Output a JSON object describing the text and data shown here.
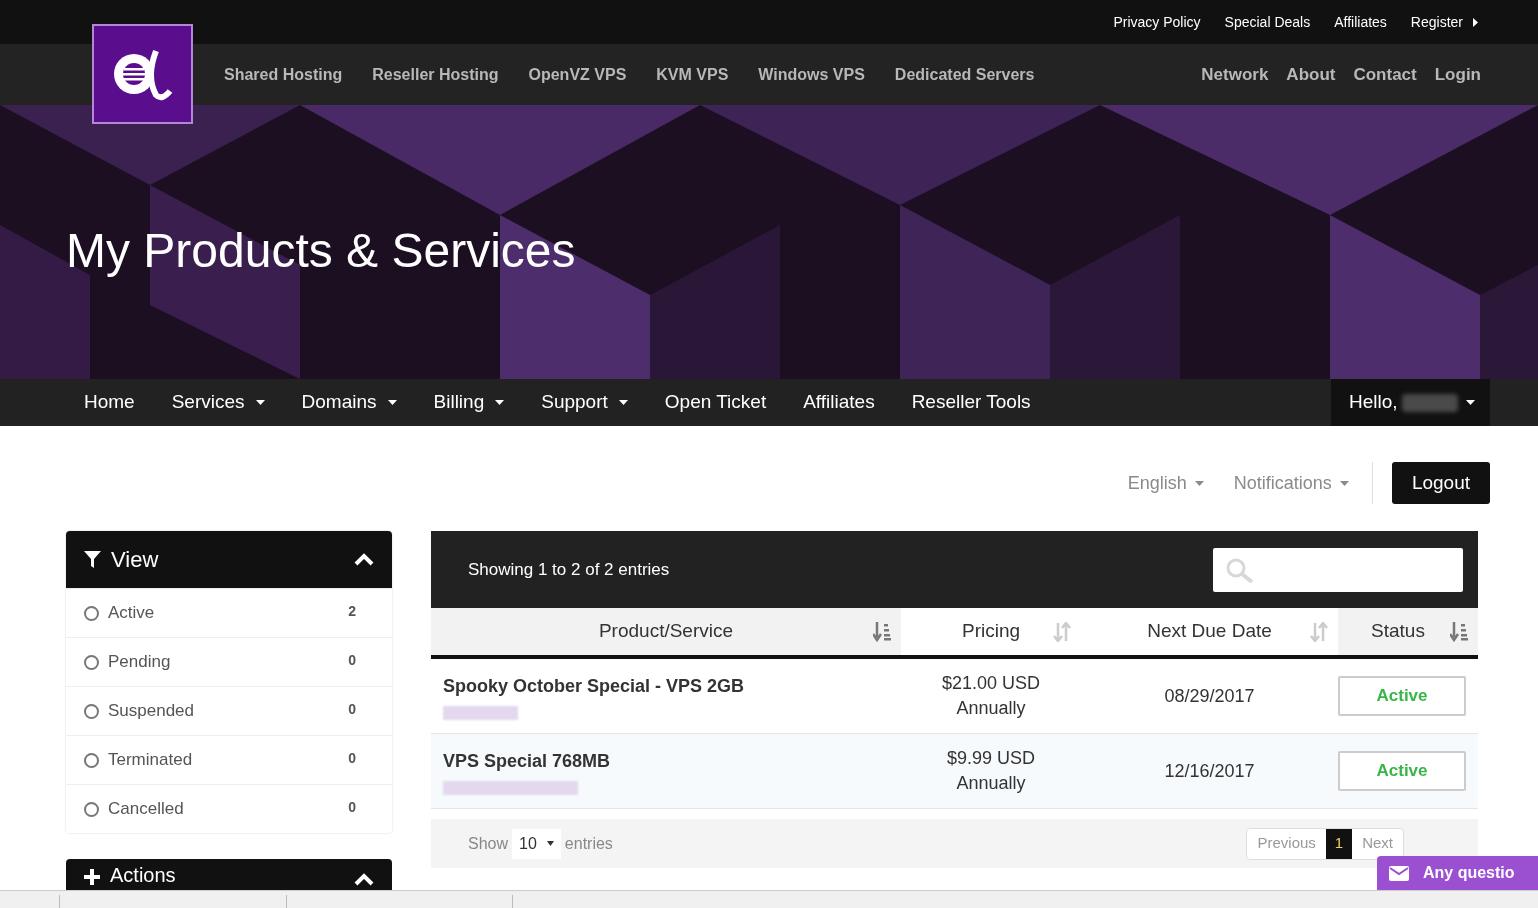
{
  "top_links": [
    {
      "label": "Privacy Policy",
      "dropdown": false
    },
    {
      "label": "Special Deals",
      "dropdown": false
    },
    {
      "label": "Affiliates",
      "dropdown": false
    },
    {
      "label": "Register",
      "dropdown": true
    }
  ],
  "main_nav": [
    "Shared Hosting",
    "Reseller Hosting",
    "OpenVZ VPS",
    "KVM VPS",
    "Windows VPS",
    "Dedicated Servers"
  ],
  "right_nav": [
    "Network",
    "About",
    "Contact",
    "Login"
  ],
  "hero": {
    "title": "My Products & Services"
  },
  "client_nav": [
    {
      "label": "Home",
      "dropdown": false
    },
    {
      "label": "Services",
      "dropdown": true
    },
    {
      "label": "Domains",
      "dropdown": true
    },
    {
      "label": "Billing",
      "dropdown": true
    },
    {
      "label": "Support",
      "dropdown": true
    },
    {
      "label": "Open Ticket",
      "dropdown": false
    },
    {
      "label": "Affiliates",
      "dropdown": false
    },
    {
      "label": "Reseller Tools",
      "dropdown": false
    }
  ],
  "user_menu": {
    "label": "Hello,"
  },
  "utility": {
    "language": "English",
    "notifications": "Notifications",
    "logout": "Logout"
  },
  "view_panel": {
    "title": "View",
    "expanded": true,
    "items": [
      {
        "label": "Active",
        "count": "2",
        "selected": false
      },
      {
        "label": "Pending",
        "count": "0",
        "selected": false
      },
      {
        "label": "Suspended",
        "count": "0",
        "selected": false
      },
      {
        "label": "Terminated",
        "count": "0",
        "selected": false
      },
      {
        "label": "Cancelled",
        "count": "0",
        "selected": false
      }
    ]
  },
  "actions_panel": {
    "title": "Actions",
    "expanded": true
  },
  "table": {
    "info": "Showing 1 to 2 of 2 entries",
    "columns": [
      {
        "label": "Product/Service",
        "sorted": true
      },
      {
        "label": "Pricing",
        "sorted": false
      },
      {
        "label": "Next Due Date",
        "sorted": false
      },
      {
        "label": "Status",
        "sorted": true
      }
    ],
    "rows": [
      {
        "product": "Spooky October Special - VPS 2GB",
        "price": "$21.00 USD",
        "cycle": "Annually",
        "next_due": "08/29/2017",
        "status": "Active"
      },
      {
        "product": "VPS Special 768MB",
        "price": "$9.99 USD",
        "cycle": "Annually",
        "next_due": "12/16/2017",
        "status": "Active"
      }
    ],
    "footer": {
      "show_label": "Show",
      "page_size": "10",
      "entries_label": "entries",
      "previous": "Previous",
      "pages": [
        {
          "label": "1",
          "selected": true
        }
      ],
      "next": "Next"
    }
  },
  "chat": {
    "label": "Any questio"
  }
}
